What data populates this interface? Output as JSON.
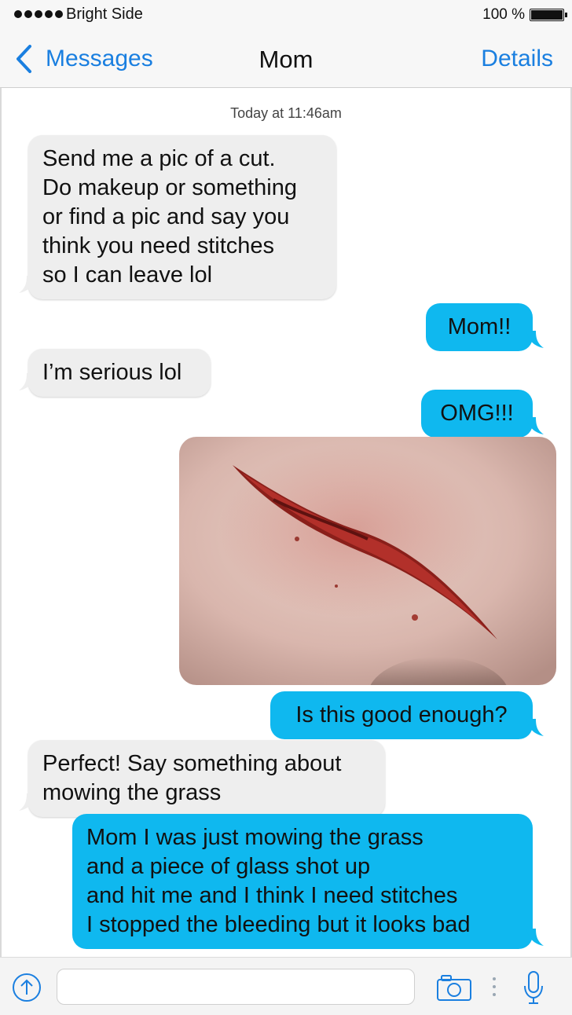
{
  "status_bar": {
    "carrier": "Bright Side",
    "battery": "100 %"
  },
  "nav": {
    "back_label": "Messages",
    "title": "Mom",
    "details_label": "Details"
  },
  "timestamp": "Today at 11:46am",
  "messages": [
    {
      "direction": "incoming",
      "lines": [
        "Send me a pic of a cut.",
        "Do makeup or something",
        "or find a pic and say you",
        "think you need stitches",
        "so I can leave lol"
      ]
    },
    {
      "direction": "outgoing",
      "lines": [
        "Mom!!"
      ]
    },
    {
      "direction": "incoming",
      "lines": [
        "I’m serious lol"
      ]
    },
    {
      "direction": "outgoing",
      "lines": [
        "OMG!!!"
      ]
    },
    {
      "direction": "outgoing",
      "type": "image",
      "image": "photo of a cut on skin"
    },
    {
      "direction": "outgoing",
      "lines": [
        "Is this good enough?"
      ]
    },
    {
      "direction": "incoming",
      "lines": [
        "Perfect! Say something about",
        "mowing the grass"
      ]
    },
    {
      "direction": "outgoing",
      "lines": [
        "Mom I was just mowing the grass",
        "and a piece of glass shot up",
        "and hit me and I think I need stitches",
        "I stopped the bleeding but it looks bad"
      ]
    }
  ],
  "input_bar": {
    "placeholder": "",
    "icons": [
      "share-up-arrow-icon",
      "camera-icon",
      "microphone-icon"
    ]
  },
  "colors": {
    "accent": "#1a7fe0",
    "outgoing_bubble": "#0fb8ef",
    "incoming_bubble": "#eeeeee"
  }
}
